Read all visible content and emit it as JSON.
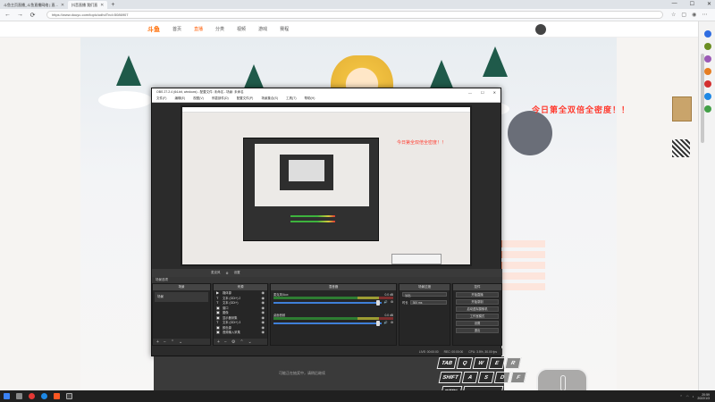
{
  "browser": {
    "tabs": [
      {
        "label": "斗鱼主页直播_斗鱼直播网络 | 直..."
      },
      {
        "label": "抖音直播 我们直"
      }
    ],
    "new_tab": "+",
    "window_controls": {
      "minimize": "—",
      "maximize": "☐",
      "close": "✕"
    },
    "nav": {
      "back": "←",
      "forward": "→",
      "refresh": "⟳"
    },
    "url": "https://www.douyu.com/topic/udhdTnd=5086907"
  },
  "site": {
    "logo": "斗鱼",
    "nav": [
      "首页",
      "直播",
      "分类",
      "视频",
      "游戏",
      "赛程"
    ],
    "promo": "今日第全双倍全密度！！",
    "bottom_caption": "可能正在抽奖中，请稍后继续"
  },
  "obs": {
    "title": "OBS 27.2.4 (64-bit, windows) - 配置文件: 未命名 - 场景: 未命名",
    "window_controls": {
      "minimize": "—",
      "maximize": "☐",
      "close": "✕"
    },
    "menu": [
      "文件(F)",
      "编辑(E)",
      "视图(V)",
      "停靠部件(D)",
      "配置文件(P)",
      "场景集合(S)",
      "工具(T)",
      "帮助(H)"
    ],
    "preview_promo": "今日第全双倍全密度！！",
    "preview_controls": {
      "mic_label": "麦克风",
      "settings_label": "设置"
    },
    "panels_title": "场景选项",
    "scenes": {
      "title": "场景",
      "items": [
        "场景"
      ]
    },
    "sources": {
      "title": "来源",
      "items": [
        {
          "icon": "▶",
          "label": "媒体源"
        },
        {
          "icon": "T",
          "label": "文本 (GDI+) 2"
        },
        {
          "icon": "T",
          "label": "文本 (GDI+)"
        },
        {
          "icon": "▣",
          "label": "窗口"
        },
        {
          "icon": "▣",
          "label": "图像"
        },
        {
          "icon": "▣",
          "label": "显示器采集"
        },
        {
          "icon": "T",
          "label": "文本 (GDI+) 3"
        },
        {
          "icon": "▣",
          "label": "颜色源"
        },
        {
          "icon": "▣",
          "label": "音频输入采集"
        }
      ]
    },
    "mixer": {
      "title": "混音器",
      "channels": [
        {
          "name": "麦克风/Aux",
          "db": "0.0 dB"
        },
        {
          "name": "桌面音频",
          "db": "0.0 dB"
        }
      ]
    },
    "transitions": {
      "title": "场景过渡",
      "type": "淡出",
      "duration_label": "时长",
      "duration": "300 ms"
    },
    "controls": {
      "title": "控件",
      "buttons": [
        "开始直播",
        "开始录制",
        "启动虚拟摄像机",
        "工作室模式",
        "设置",
        "退出"
      ]
    },
    "statusbar": {
      "live": "LIVE: 00:00:00",
      "rec": "REC: 00:00:00",
      "cpu": "CPU: 3.5%, 30.00 fps"
    }
  },
  "key_overlay": {
    "keys": [
      "TAB",
      "Q",
      "W",
      "E",
      "R",
      "SHIFT",
      "A",
      "S",
      "D",
      "F",
      "CTRL"
    ]
  },
  "taskbar": {
    "clock_time": "20:59",
    "clock_date": "2022/1/3"
  }
}
